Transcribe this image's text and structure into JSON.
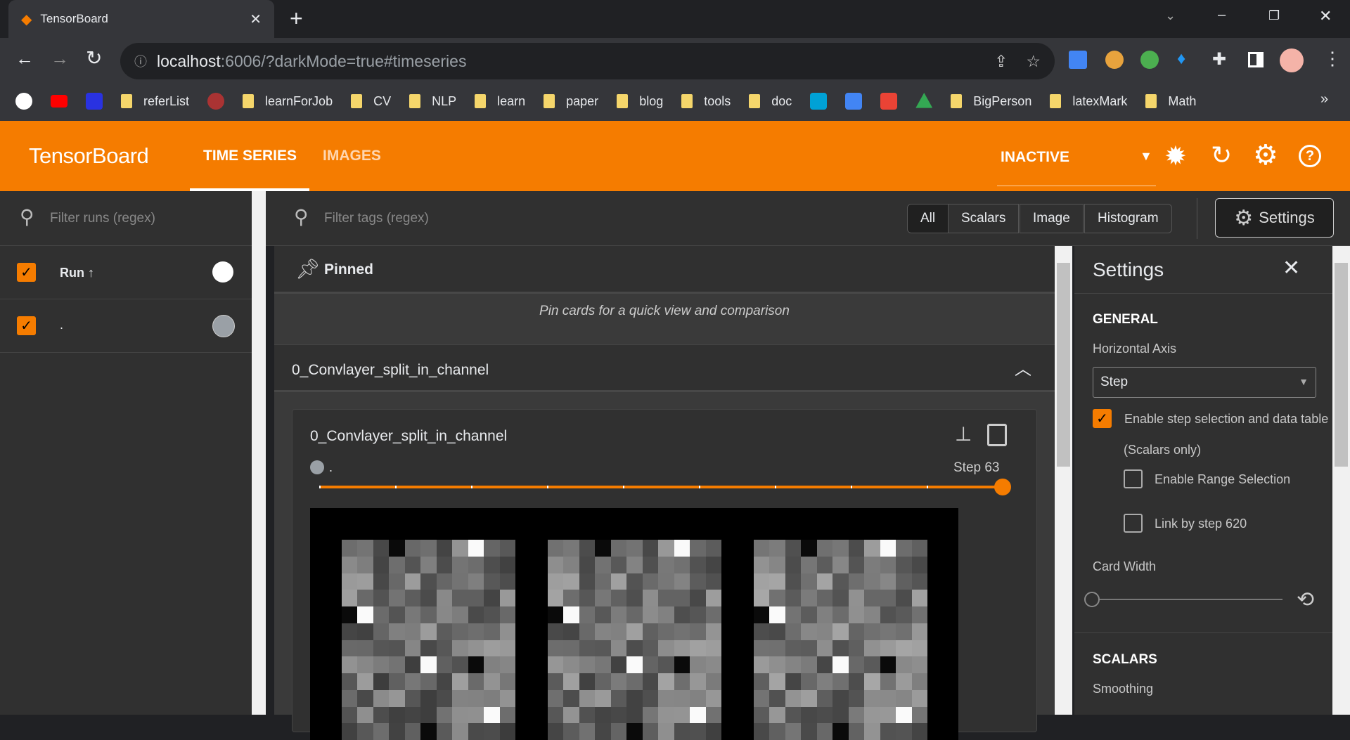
{
  "browser": {
    "tab_title": "TensorBoard",
    "url_host": "localhost",
    "url_rest": ":6006/?darkMode=true#timeseries",
    "bookmarks": [
      "referList",
      "learnForJob",
      "CV",
      "NLP",
      "learn",
      "paper",
      "blog",
      "tools",
      "doc",
      "BigPerson",
      "latexMark",
      "Math"
    ]
  },
  "header": {
    "logo": "TensorBoard",
    "tabs": [
      "TIME SERIES",
      "IMAGES"
    ],
    "status": "INACTIVE"
  },
  "runs": {
    "filter_placeholder": "Filter runs (regex)",
    "column": "Run ↑",
    "items": [
      {
        "name": ".",
        "checked": true,
        "color": "#9aa0a6"
      }
    ]
  },
  "main": {
    "filter_placeholder": "Filter tags (regex)",
    "type_filters": [
      "All",
      "Scalars",
      "Image",
      "Histogram"
    ],
    "settings_button": "Settings",
    "pinned_title": "Pinned",
    "pinned_hint": "Pin cards for a quick view and comparison",
    "group_title": "0_Convlayer_split_in_channel",
    "card": {
      "title": "0_Convlayer_split_in_channel",
      "run": ".",
      "step_label": "Step 63",
      "step_progress": 1.0
    }
  },
  "settings": {
    "title": "Settings",
    "general": "GENERAL",
    "horizontal_axis_label": "Horizontal Axis",
    "horizontal_axis_value": "Step",
    "enable_step": "Enable step selection and data table",
    "scalars_only": "(Scalars only)",
    "enable_step_checked": true,
    "range_selection": "Enable Range Selection",
    "link_by_step": "Link by step 620",
    "card_width": "Card Width",
    "card_width_value": 0,
    "scalars": "SCALARS",
    "smoothing": "Smoothing"
  },
  "colors": {
    "accent": "#f57c00",
    "bg": "#303030"
  }
}
